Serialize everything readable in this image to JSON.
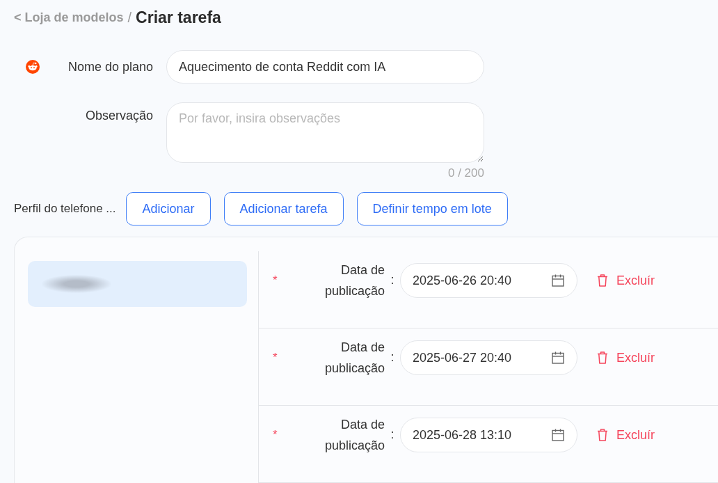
{
  "breadcrumb": {
    "back_link": "< Loja de modelos",
    "separator": "/",
    "current": "Criar tarefa"
  },
  "form": {
    "plan_name": {
      "label": "Nome do plano",
      "value": "Aquecimento de conta Reddit com IA"
    },
    "note": {
      "label": "Observação",
      "placeholder": "Por favor, insira observações",
      "counter": "0 / 200"
    }
  },
  "toolbar": {
    "label": "Perfil do telefone ...",
    "buttons": [
      "Adicionar",
      "Adicionar tarefa",
      "Definir tempo em lote"
    ]
  },
  "profiles": [
    {
      "selected": true
    }
  ],
  "tasks": [
    {
      "required_mark": "*",
      "label": "Data de publicação",
      "separator": ":",
      "value": "2025-06-26 20:40",
      "delete_label": "Excluír"
    },
    {
      "required_mark": "*",
      "label": "Data de publicação",
      "separator": ":",
      "value": "2025-06-27 20:40",
      "delete_label": "Excluír"
    },
    {
      "required_mark": "*",
      "label": "Data de publicação",
      "separator": ":",
      "value": "2025-06-28 13:10",
      "delete_label": "Excluír"
    }
  ]
}
